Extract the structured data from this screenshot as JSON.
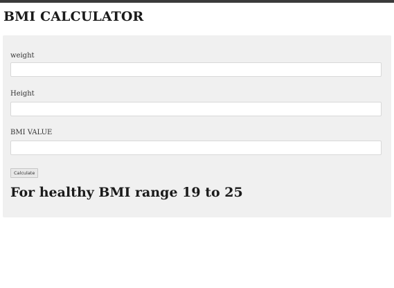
{
  "page": {
    "title": "BMI CALCULATOR"
  },
  "form": {
    "weight": {
      "label": "weight",
      "value": ""
    },
    "height": {
      "label": "Height",
      "value": ""
    },
    "bmi": {
      "label": "BMI VALUE",
      "value": ""
    },
    "calculate_label": "Calculate",
    "info": "For healthy BMI range 19 to 25"
  },
  "colors": {
    "top_bar": "#3a3a3a",
    "panel_background": "#f0f0f0",
    "input_background": "#ffffff",
    "text": "#1a1a1a"
  }
}
